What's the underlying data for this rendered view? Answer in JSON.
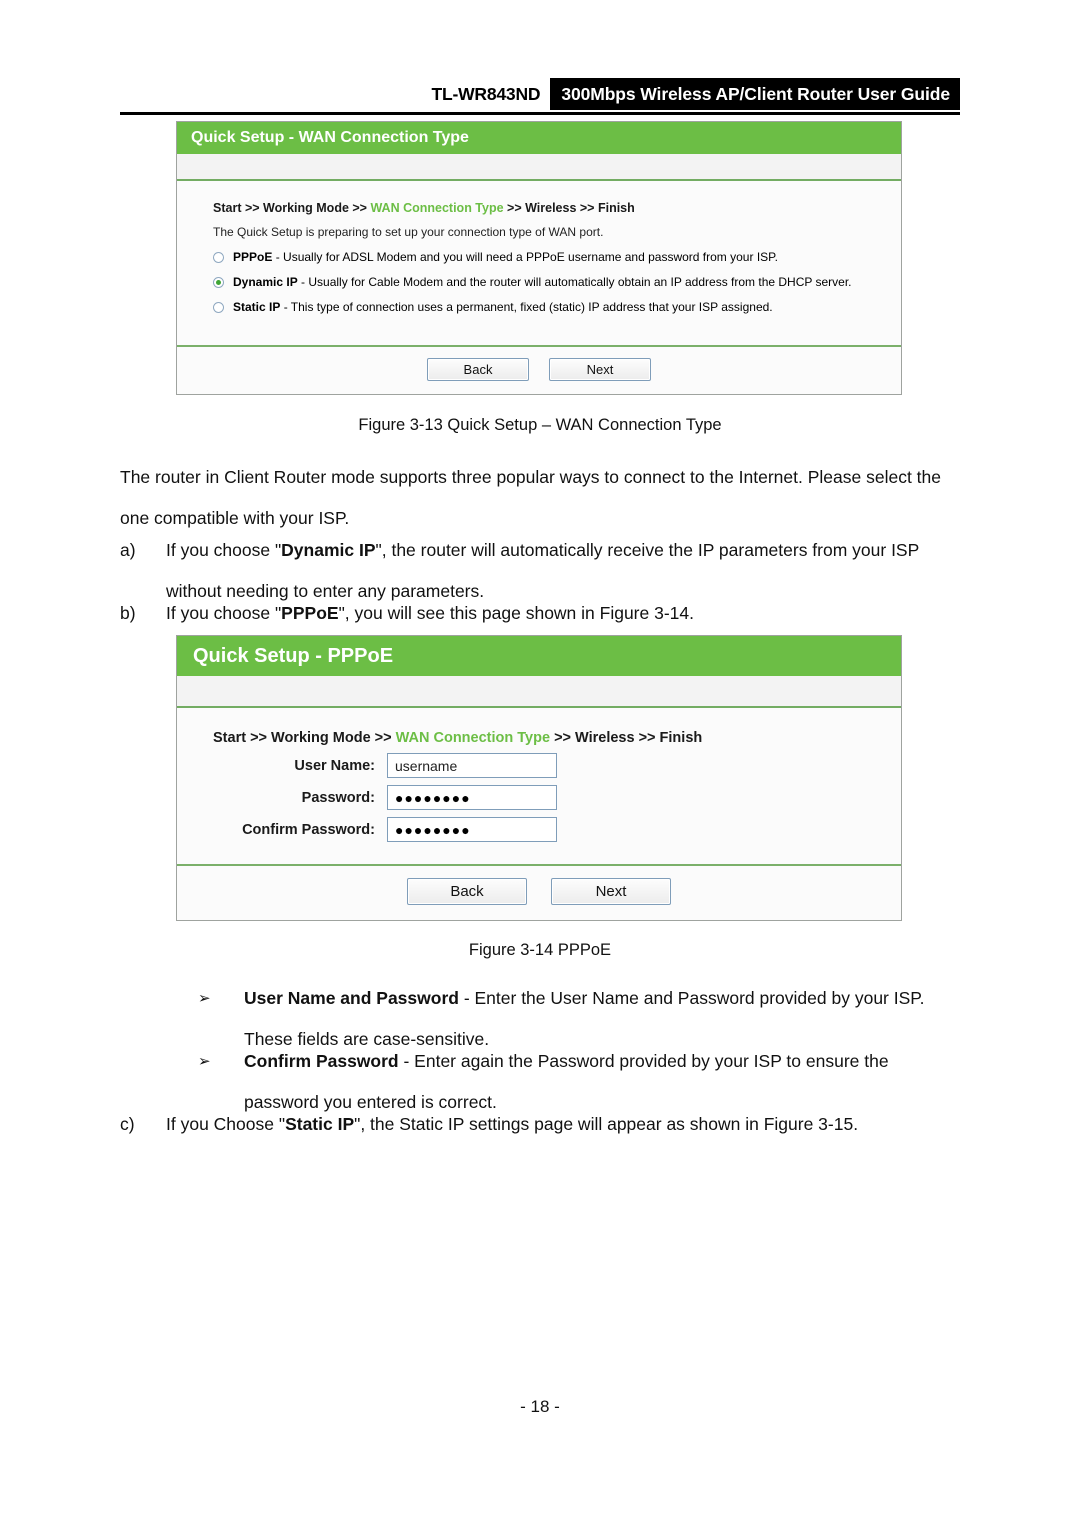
{
  "header": {
    "model": "TL-WR843ND",
    "title": "300Mbps Wireless AP/Client Router User Guide"
  },
  "shot_wan": {
    "panel_title": "Quick Setup - WAN Connection Type",
    "breadcrumb": {
      "before": "Start >> Working Mode >> ",
      "active": "WAN Connection Type",
      "after": " >> Wireless >> Finish"
    },
    "description": "The Quick Setup is preparing to set up your connection type of WAN port.",
    "options": [
      {
        "name": "PPPoE",
        "text": " - Usually for ADSL Modem and you will need a PPPoE username and password from your ISP.",
        "selected": false
      },
      {
        "name": "Dynamic IP",
        "text": " - Usually for Cable Modem and the router will automatically obtain an IP address from the DHCP server.",
        "selected": true
      },
      {
        "name": "Static IP",
        "text": " - This type of connection uses a permanent, fixed (static) IP address that your ISP assigned.",
        "selected": false
      }
    ],
    "back_label": "Back",
    "next_label": "Next"
  },
  "shot_pppoe": {
    "panel_title": "Quick Setup - PPPoE",
    "breadcrumb": {
      "before": "Start >> Working Mode >> ",
      "active": "WAN Connection Type",
      "after": " >> Wireless >> Finish"
    },
    "fields": [
      {
        "label": "User Name:",
        "value": "username",
        "masked": false
      },
      {
        "label": "Password:",
        "value": "●●●●●●●●",
        "masked": true
      },
      {
        "label": "Confirm Password:",
        "value": "●●●●●●●●",
        "masked": true
      }
    ],
    "back_label": "Back",
    "next_label": "Next"
  },
  "captions": {
    "figure_3_13": "Figure 3-13 Quick Setup – WAN Connection Type",
    "figure_3_14": "Figure 3-14 PPPoE"
  },
  "body": {
    "intro": "The router in Client Router mode supports three popular ways to connect to the Internet. Please select the one compatible with your ISP.",
    "item_a": {
      "marker": "a)",
      "lead_prefix": "If you choose \"",
      "lead_bold": "Dynamic IP",
      "rest": "\", the router will automatically receive the IP parameters from your ISP without needing to enter any parameters."
    },
    "item_b": {
      "marker": "b)",
      "lead_prefix": "If you choose \"",
      "lead_bold": "PPPoE",
      "rest": "\", you will see this page shown in Figure 3-14."
    },
    "bullet_1": {
      "marker": "➢",
      "bold": "User Name and Password",
      "rest": " - Enter the User Name and Password provided by your ISP. These fields are case-sensitive."
    },
    "bullet_2": {
      "marker": "➢",
      "bold": "Confirm Password",
      "rest": " - Enter again the Password provided by your ISP to ensure the password you entered is correct."
    },
    "item_c": {
      "marker": "c)",
      "lead_prefix": "If you Choose \"",
      "lead_bold": "Static IP",
      "rest": "\", the Static IP settings page will appear as shown in Figure 3-15."
    }
  },
  "page_number": "- 18 -",
  "colors": {
    "brand_green": "#6cbe45",
    "header_band": "#000000",
    "radio_selected": "#3fa535"
  }
}
